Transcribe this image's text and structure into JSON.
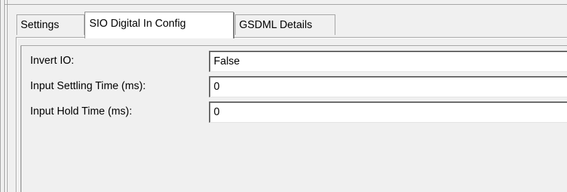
{
  "tabs": [
    {
      "label": "Settings",
      "active": false
    },
    {
      "label": "SIO Digital In Config",
      "active": true
    },
    {
      "label": "GSDML Details",
      "active": false
    }
  ],
  "fields": [
    {
      "label": "Invert IO:",
      "value": "False"
    },
    {
      "label": "Input Settling Time (ms):",
      "value": "0"
    },
    {
      "label": "Input Hold Time (ms):",
      "value": "0"
    }
  ]
}
